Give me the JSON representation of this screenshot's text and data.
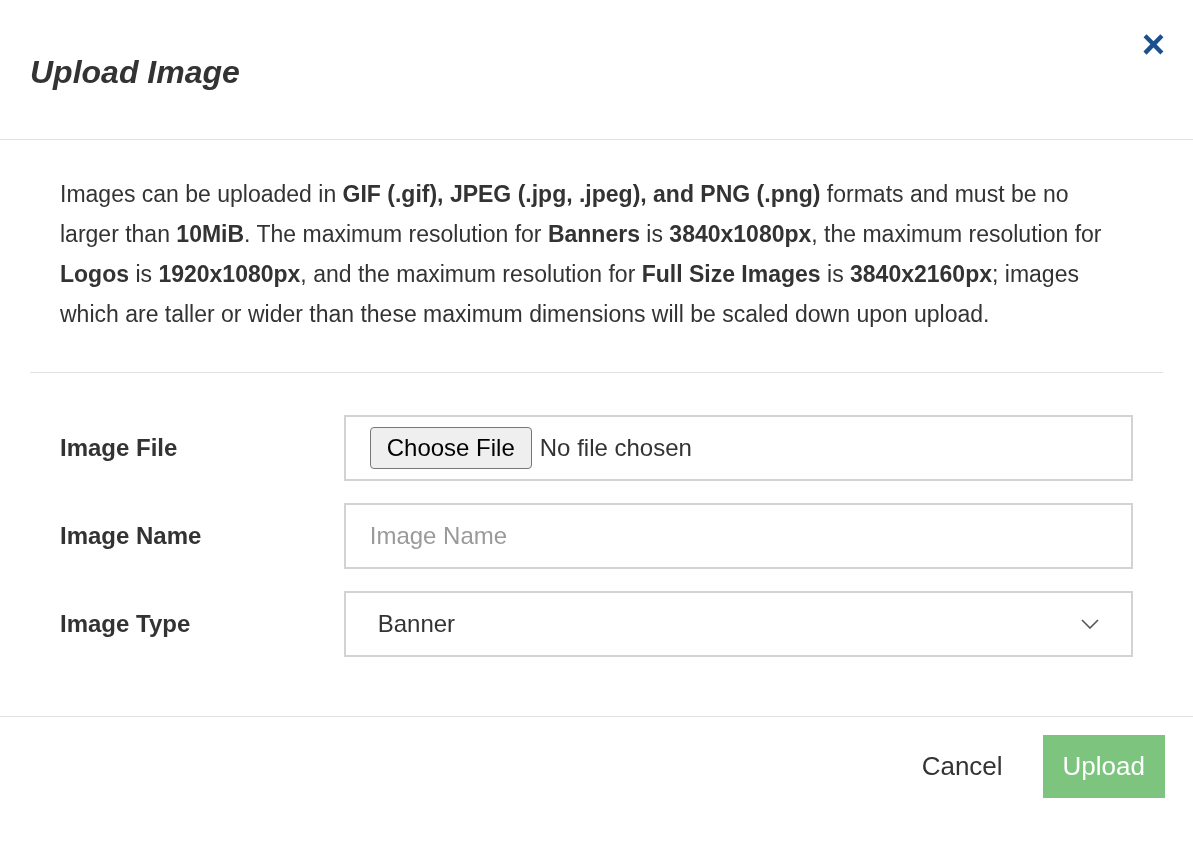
{
  "dialog": {
    "title": "Upload Image",
    "close": "×"
  },
  "description": "Images can be uploaded in **GIF (.gif), JPEG (.jpg, .jpeg), and PNG (.png)** formats and must be no larger than **10MiB**. The maximum resolution for **Banners** is **3840x1080px**, the maximum resolution for **Logos** is **1920x1080px**, and the maximum resolution for **Full Size Images** is **3840x2160px**; images which are taller or wider than these maximum dimensions will be scaled down upon upload.",
  "fields": [
    {
      "kind": "file",
      "label": "Image File",
      "button": "Choose File",
      "status": "No file chosen"
    },
    {
      "kind": "text",
      "label": "Image Name",
      "placeholder": "Image Name"
    },
    {
      "kind": "select",
      "label": "Image Type",
      "value": "Banner"
    }
  ],
  "buttons": [
    {
      "kind": "secondary",
      "label": "Cancel",
      "disabled": false
    },
    {
      "kind": "primary",
      "label": "Upload",
      "disabled": true
    }
  ]
}
